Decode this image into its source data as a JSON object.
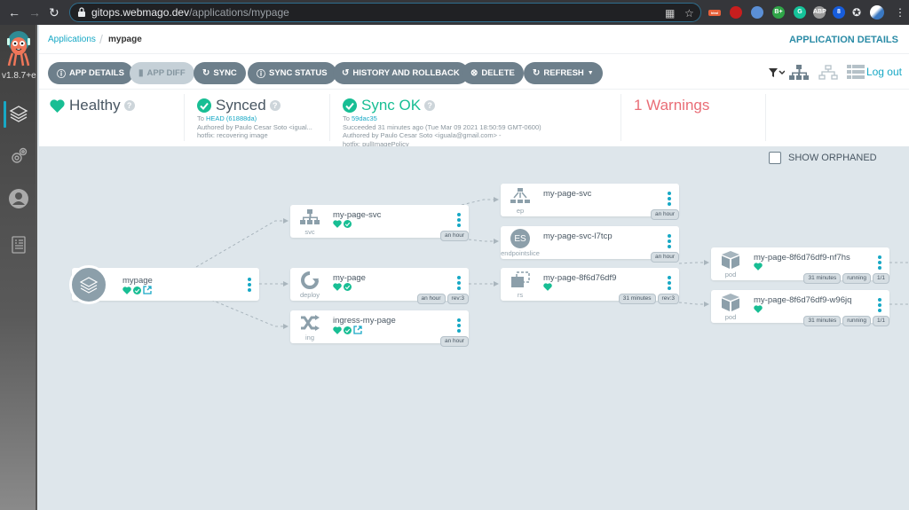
{
  "browser": {
    "url_host": "gitops.webmago.dev",
    "url_path": "/applications/mypage",
    "extensions": [
      {
        "name": "ext-html",
        "label": "html",
        "color": "#e8613a"
      },
      {
        "name": "ext-red",
        "label": "",
        "color": "#c81e1e"
      },
      {
        "name": "ext-globe",
        "label": "",
        "color": "#5b8fd6"
      },
      {
        "name": "ext-bplus",
        "label": "B+",
        "color": "#2fa548"
      },
      {
        "name": "ext-grammarly",
        "label": "G",
        "color": "#15c39a"
      },
      {
        "name": "ext-abp",
        "label": "ABP",
        "color": "#9a9a9a"
      },
      {
        "name": "ext-bitwarden",
        "label": "8",
        "color": "#175ddc"
      }
    ]
  },
  "sidebar": {
    "version": "v1.8.7+e",
    "items": [
      {
        "name": "applications",
        "active": true
      },
      {
        "name": "settings",
        "active": false
      },
      {
        "name": "user-info",
        "active": false
      },
      {
        "name": "documentation",
        "active": false
      }
    ]
  },
  "header": {
    "breadcrumb_root": "Applications",
    "breadcrumb_separator": "/",
    "breadcrumb_current": "mypage",
    "page_title": "APPLICATION DETAILS"
  },
  "toolbar": {
    "buttons": [
      {
        "label": "APP DETAILS",
        "icon": "info-icon",
        "disabled": false
      },
      {
        "label": "APP DIFF",
        "icon": "file-icon",
        "disabled": true
      },
      {
        "label": "SYNC",
        "icon": "sync-icon",
        "disabled": false
      },
      {
        "label": "SYNC STATUS",
        "icon": "info-icon",
        "disabled": false
      },
      {
        "label": "HISTORY AND ROLLBACK",
        "icon": "history-icon",
        "disabled": false
      },
      {
        "label": "DELETE",
        "icon": "times-circle-icon",
        "disabled": false
      },
      {
        "label": "REFRESH",
        "icon": "redo-icon",
        "disabled": false
      }
    ],
    "logout_label": "Log out"
  },
  "status": {
    "health": {
      "label": "Healthy",
      "color": "#18be94"
    },
    "sync": {
      "label": "Synced",
      "to_prefix": "To",
      "revision": "HEAD (61888da)",
      "author": "Authored by Paulo Cesar Soto <igual...",
      "message": "hotfix: recovering image"
    },
    "operation": {
      "label": "Sync OK",
      "to_prefix": "To",
      "revision": "59dac35",
      "detail": "Succeeded 31 minutes ago (Tue Mar 09 2021 18:50:59 GMT-0600)",
      "author": "Authored by Paulo Cesar Soto <iguala@gmail.com> -",
      "message": "hotfix: pullImagePolicy"
    },
    "warnings": {
      "label": "1 Warnings",
      "color": "#e96d76"
    }
  },
  "canvas": {
    "show_orphaned_label": "SHOW ORPHANED",
    "show_orphaned_checked": false
  },
  "nodes": {
    "app": {
      "name": "mypage",
      "kind": "",
      "health": true,
      "synced": true,
      "external_link": true
    },
    "svc": {
      "name": "my-page-svc",
      "kind": "svc",
      "health": true,
      "synced": true,
      "tags": [
        "an hour"
      ]
    },
    "deploy": {
      "name": "my-page",
      "kind": "deploy",
      "health": true,
      "synced": true,
      "tags": [
        "an hour",
        "rev:3"
      ]
    },
    "ing": {
      "name": "ingress-my-page",
      "kind": "ing",
      "health": true,
      "synced": true,
      "external_link": true,
      "tags": [
        "an hour"
      ]
    },
    "ep": {
      "name": "my-page-svc",
      "kind": "ep",
      "tags": [
        "an hour"
      ]
    },
    "es": {
      "name": "my-page-svc-l7tcp",
      "kind": "endpointslice",
      "icon_text": "ES",
      "tags": [
        "an hour"
      ]
    },
    "rs": {
      "name": "my-page-8f6d76df9",
      "kind": "rs",
      "health": true,
      "tags": [
        "31 minutes",
        "rev:3"
      ]
    },
    "pod1": {
      "name": "my-page-8f6d76df9-nf7hs",
      "kind": "pod",
      "health": true,
      "tags": [
        "31 minutes",
        "running",
        "1/1"
      ]
    },
    "pod2": {
      "name": "my-page-8f6d76df9-w96jq",
      "kind": "pod",
      "health": true,
      "tags": [
        "31 minutes",
        "running",
        "1/1"
      ]
    }
  },
  "colors": {
    "accent": "#17a8c5",
    "healthy": "#18be94",
    "button": "#6d7f8b",
    "warning": "#e96d76",
    "icon_gray": "#8c9faa"
  }
}
